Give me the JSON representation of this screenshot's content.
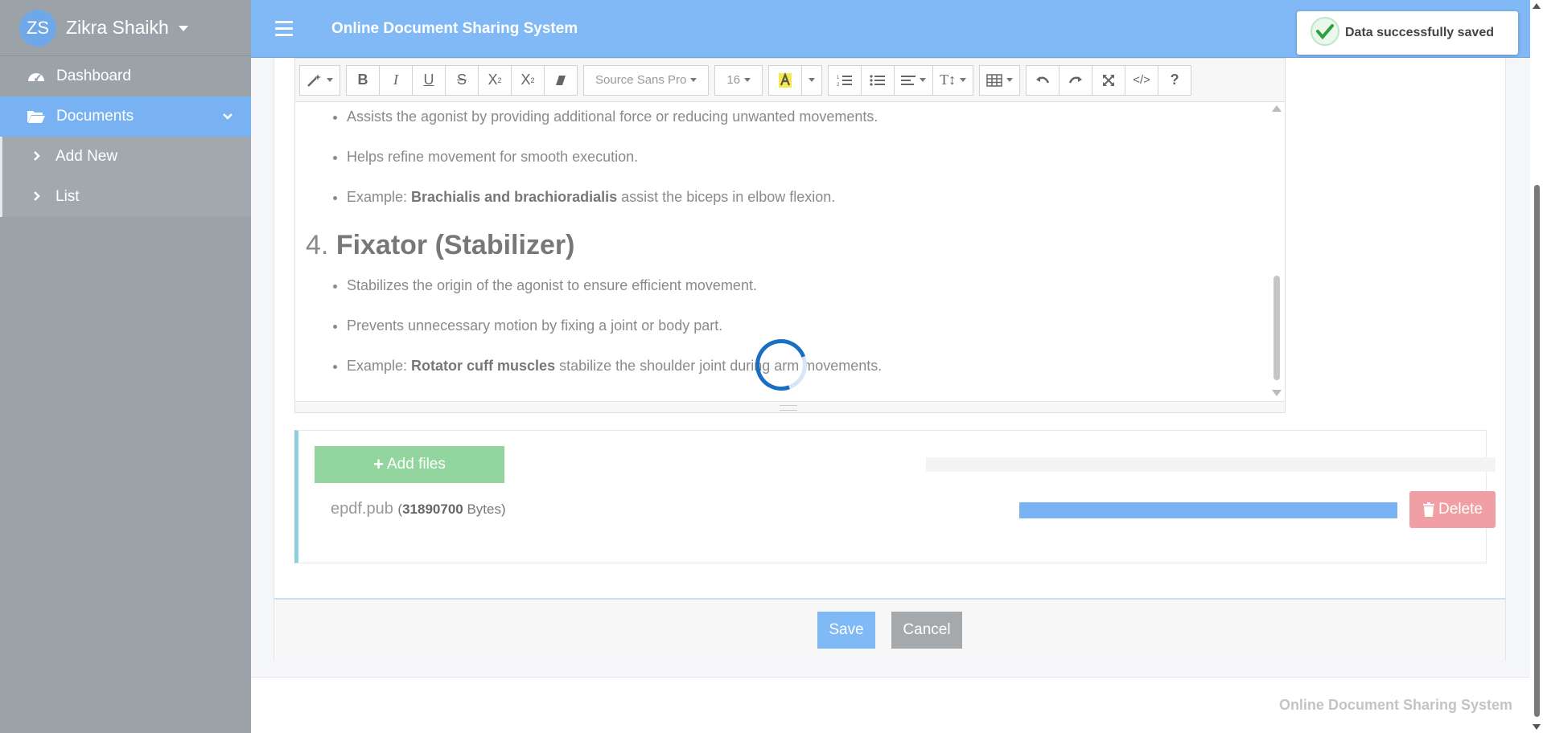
{
  "user": {
    "initials": "ZS",
    "name": "Zikra Shaikh"
  },
  "sidebar": {
    "items": [
      {
        "label": "Dashboard",
        "icon": "dashboard-icon"
      },
      {
        "label": "Documents",
        "icon": "folder-open-icon"
      }
    ],
    "subitems": [
      {
        "label": "Add New"
      },
      {
        "label": "List"
      }
    ]
  },
  "header": {
    "title": "Online Document Sharing System"
  },
  "toast": {
    "message": "Data successfully saved",
    "color": "#2e9e3e"
  },
  "editor": {
    "toolbar": {
      "font_name": "Source Sans Pro",
      "font_size": "16",
      "code_label": "</>",
      "help_label": "?",
      "superscript_label": "X",
      "subscript_label": "X",
      "textsize_label": "T↕"
    },
    "content": {
      "list1": [
        {
          "text": "Assists the agonist by providing additional force or reducing unwanted movements."
        },
        {
          "text": "Helps refine movement for smooth execution."
        },
        {
          "prefix": "Example: ",
          "bold": "Brachialis and brachioradialis",
          "suffix": " assist the biceps in elbow flexion."
        }
      ],
      "heading": {
        "number": "4.",
        "text": "Fixator (Stabilizer)"
      },
      "list2": [
        {
          "text": "Stabilizes the origin of the agonist to ensure efficient movement."
        },
        {
          "text": "Prevents unnecessary motion by fixing a joint or body part."
        },
        {
          "prefix": "Example: ",
          "bold": "Rotator cuff muscles",
          "suffix": " stabilize the shoulder joint during arm movements."
        }
      ]
    }
  },
  "upload": {
    "add_label": "Add files",
    "file": {
      "name": "epdf.pub",
      "size": "31890700",
      "unit": "Bytes",
      "progress": 1.0
    },
    "delete_label": "Delete"
  },
  "actions": {
    "save": "Save",
    "cancel": "Cancel"
  },
  "footer": {
    "text": "Online Document Sharing System"
  },
  "colors": {
    "accent": "#80b9f6",
    "sidebar": "#9ca3a8",
    "success": "#93d59e",
    "danger": "#f0a0a4"
  }
}
